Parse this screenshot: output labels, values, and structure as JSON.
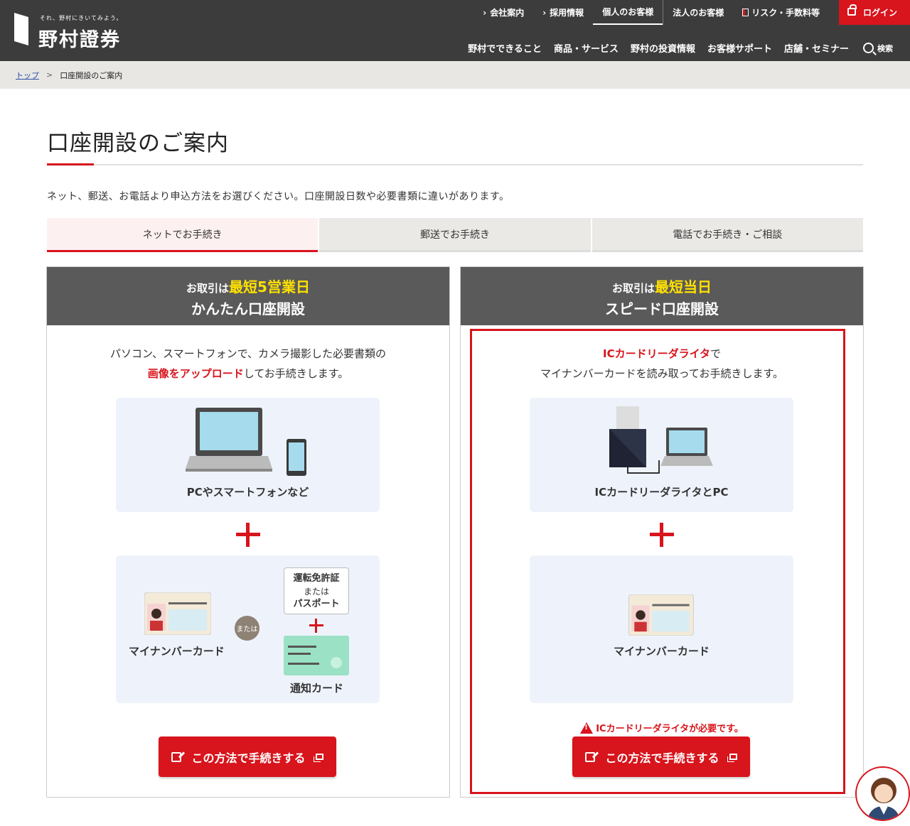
{
  "header": {
    "logo_tagline": "それ、野村にきいてみよう。",
    "logo_name": "野村證券",
    "top_links": [
      "会社案内",
      "採用情報",
      "個人のお客様",
      "法人のお客様",
      "リスク・手数料等"
    ],
    "login_label": "ログイン",
    "main_nav": [
      "野村でできること",
      "商品・サービス",
      "野村の投資情報",
      "お客様サポート",
      "店舗・セミナー"
    ],
    "search_label": "検索",
    "accent_color": "#d8141c",
    "header_bg": "#3c3c3c"
  },
  "breadcrumb": {
    "home": "トップ",
    "current": "口座開設のご案内"
  },
  "page": {
    "title": "口座開設のご案内",
    "lead": "ネット、郵送、お電話より申込方法をお選びください。口座開設日数や必要書類に違いがあります。"
  },
  "tabs": [
    {
      "label": "ネットでお手続き",
      "active": true
    },
    {
      "label": "郵送でお手続き",
      "active": false
    },
    {
      "label": "電話でお手続き・ご相談",
      "active": false
    }
  ],
  "cards": {
    "left": {
      "head_prefix": "お取引は",
      "head_highlight": "最短5営業日",
      "head_title": "かんたん口座開設",
      "desc_line1": "パソコン、スマートフォンで、カメラ撮影した必要書類の",
      "desc_red": "画像をアップロード",
      "desc_line2_rest": "してお手続きします。",
      "device_label": "PCやスマートフォンなど",
      "card_label": "マイナンバーカード",
      "or_label": "または",
      "doc_line1": "運転免許証",
      "doc_line2": "または",
      "doc_line3": "パスポート",
      "notice_card_label": "通知カード",
      "button_label": "この方法で手続きする"
    },
    "right": {
      "head_prefix": "お取引は",
      "head_highlight": "最短当日",
      "head_title": "スピード口座開設",
      "desc_red": "ICカードリーダライタ",
      "desc_line1_rest": "で",
      "desc_line2": "マイナンバーカードを読み取ってお手続きします。",
      "device_label": "ICカードリーダライタとPC",
      "card_label": "マイナンバーカード",
      "warning": "ICカードリーダライタが必要です。",
      "button_label": "この方法で手続きする"
    }
  }
}
